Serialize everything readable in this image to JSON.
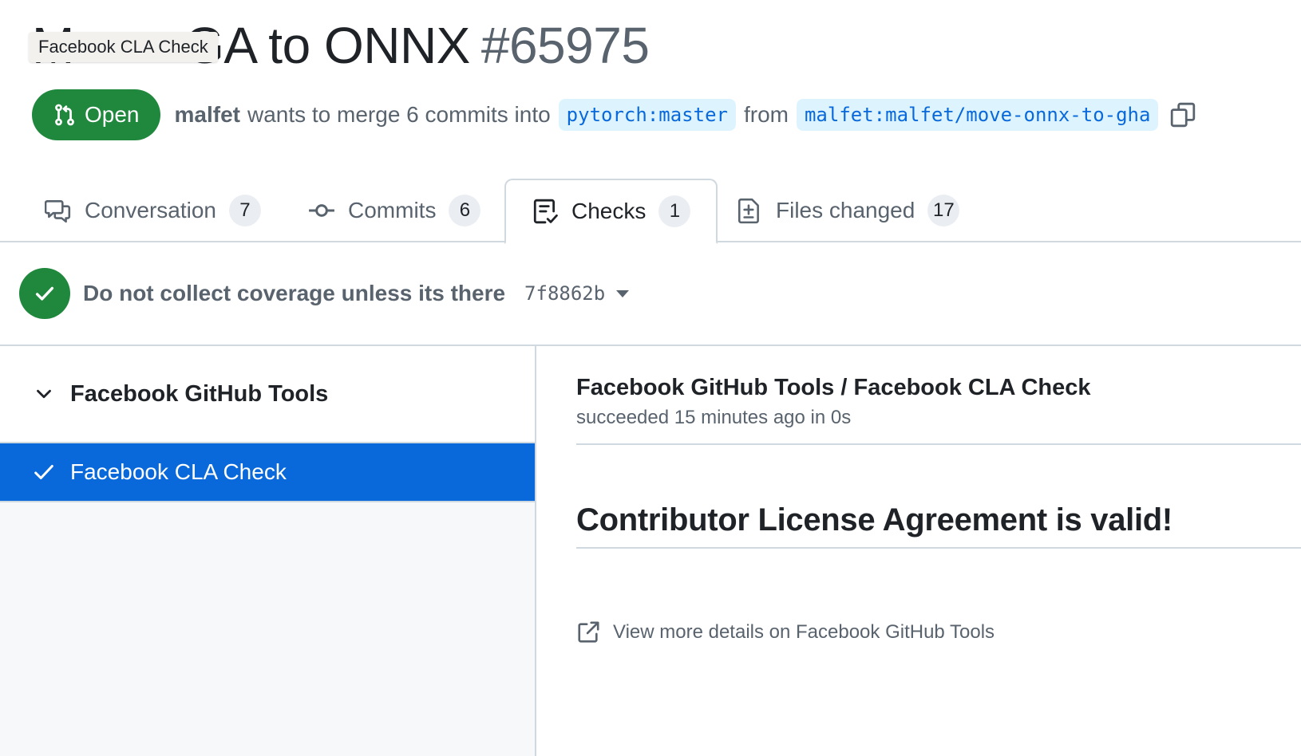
{
  "pr": {
    "title_visible": "A to ONNX",
    "number": "#65975",
    "state": "Open",
    "author": "malfet",
    "merge_text": "wants to merge 6 commits into",
    "base_branch": "pytorch:master",
    "from_text": "from",
    "head_branch": "malfet:malfet/move-onnx-to-gha"
  },
  "tooltip": {
    "text": "Facebook CLA Check"
  },
  "tabs": [
    {
      "label": "Conversation",
      "count": "7",
      "icon": "comment-discussion-icon"
    },
    {
      "label": "Commits",
      "count": "6",
      "icon": "git-commit-icon"
    },
    {
      "label": "Checks",
      "count": "1",
      "icon": "checklist-icon"
    },
    {
      "label": "Files changed",
      "count": "17",
      "icon": "file-diff-icon"
    }
  ],
  "commit": {
    "message": "Do not collect coverage unless its there",
    "sha": "7f8862b"
  },
  "sidebar": {
    "suite_name": "Facebook GitHub Tools",
    "checks": [
      {
        "name": "Facebook CLA Check",
        "selected": true
      }
    ]
  },
  "check_run": {
    "title": "Facebook GitHub Tools / Facebook CLA Check",
    "status": "succeeded 15 minutes ago in 0s",
    "summary": "Contributor License Agreement is valid!",
    "details_link": "View more details on Facebook GitHub Tools"
  },
  "colors": {
    "success": "#1f883d",
    "accent": "#0969da",
    "branch_bg": "#ddf4ff",
    "muted_text": "#59636e",
    "border": "#d1d9e0"
  }
}
